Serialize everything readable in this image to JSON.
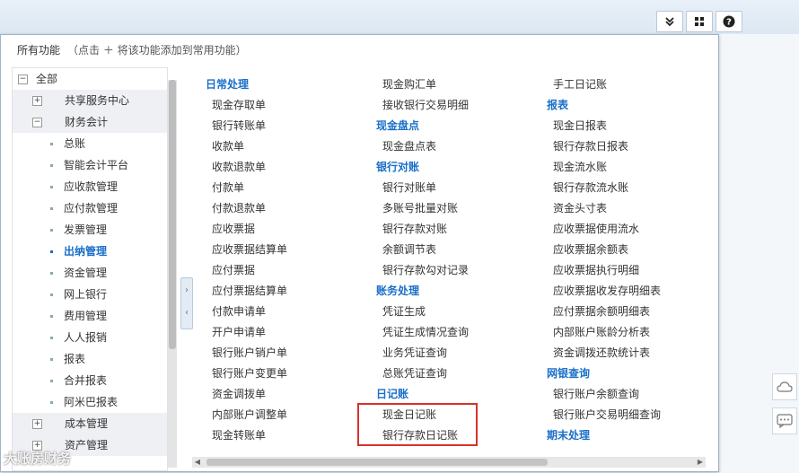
{
  "header": {
    "title": "所有功能",
    "hint": "（点击 ＋ 将该功能添加到常用功能）"
  },
  "watermark": "大账房财务",
  "tree": [
    {
      "label": "全部",
      "type": "root",
      "toggle": "−"
    },
    {
      "label": "共享服务中心",
      "type": "group",
      "toggle": "+"
    },
    {
      "label": "财务会计",
      "type": "group",
      "toggle": "−"
    },
    {
      "label": "总账",
      "type": "leaf"
    },
    {
      "label": "智能会计平台",
      "type": "leaf"
    },
    {
      "label": "应收款管理",
      "type": "leaf"
    },
    {
      "label": "应付款管理",
      "type": "leaf"
    },
    {
      "label": "发票管理",
      "type": "leaf"
    },
    {
      "label": "出纳管理",
      "type": "leaf",
      "active": true
    },
    {
      "label": "资金管理",
      "type": "leaf"
    },
    {
      "label": "网上银行",
      "type": "leaf"
    },
    {
      "label": "费用管理",
      "type": "leaf"
    },
    {
      "label": "人人报销",
      "type": "leaf"
    },
    {
      "label": "报表",
      "type": "leaf"
    },
    {
      "label": "合并报表",
      "type": "leaf"
    },
    {
      "label": "阿米巴报表",
      "type": "leaf"
    },
    {
      "label": "成本管理",
      "type": "group",
      "toggle": "+"
    },
    {
      "label": "资产管理",
      "type": "group",
      "toggle": "+"
    }
  ],
  "columns": [
    [
      {
        "label": "日常处理",
        "head": true
      },
      {
        "label": "现金存取单"
      },
      {
        "label": "银行转账单"
      },
      {
        "label": "收款单"
      },
      {
        "label": "收款退款单"
      },
      {
        "label": "付款单"
      },
      {
        "label": "付款退款单"
      },
      {
        "label": "应收票据"
      },
      {
        "label": "应收票据结算单"
      },
      {
        "label": "应付票据"
      },
      {
        "label": "应付票据结算单"
      },
      {
        "label": "付款申请单"
      },
      {
        "label": "开户申请单"
      },
      {
        "label": "银行账户销户单"
      },
      {
        "label": "银行账户变更单"
      },
      {
        "label": "资金调拨单"
      },
      {
        "label": "内部账户调整单"
      },
      {
        "label": "现金转账单"
      }
    ],
    [
      {
        "label": "现金购汇单"
      },
      {
        "label": "接收银行交易明细"
      },
      {
        "label": "现金盘点",
        "head": true
      },
      {
        "label": "现金盘点表"
      },
      {
        "label": "银行对账",
        "head": true
      },
      {
        "label": "银行对账单"
      },
      {
        "label": "多账号批量对账"
      },
      {
        "label": "银行存款对账"
      },
      {
        "label": "余额调节表"
      },
      {
        "label": "银行存款勾对记录"
      },
      {
        "label": "账务处理",
        "head": true
      },
      {
        "label": "凭证生成"
      },
      {
        "label": "凭证生成情况查询"
      },
      {
        "label": "业务凭证查询"
      },
      {
        "label": "总账凭证查询"
      },
      {
        "label": "日记账",
        "head": true
      },
      {
        "label": "现金日记账"
      },
      {
        "label": "银行存款日记账"
      }
    ],
    [
      {
        "label": "手工日记账"
      },
      {
        "label": "报表",
        "head": true
      },
      {
        "label": "现金日报表"
      },
      {
        "label": "银行存款日报表"
      },
      {
        "label": "现金流水账"
      },
      {
        "label": "银行存款流水账"
      },
      {
        "label": "资金头寸表"
      },
      {
        "label": "应收票据使用流水"
      },
      {
        "label": "应收票据余额表"
      },
      {
        "label": "应收票据执行明细"
      },
      {
        "label": "应收票据收发存明细表"
      },
      {
        "label": "应付票据余额明细表"
      },
      {
        "label": "内部账户账龄分析表"
      },
      {
        "label": "资金调拨还款统计表"
      },
      {
        "label": "网银查询",
        "head": true
      },
      {
        "label": "银行账户余额查询"
      },
      {
        "label": "银行账户交易明细查询"
      },
      {
        "label": "期末处理",
        "head": true
      }
    ]
  ]
}
